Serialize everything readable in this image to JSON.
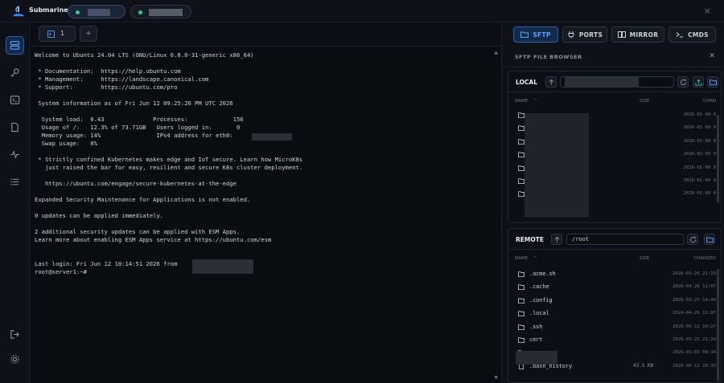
{
  "app": {
    "name": "Submarine"
  },
  "connections": [
    {
      "status_color": "#2ecc8a",
      "label": ""
    },
    {
      "status_color": "#2ecc8a",
      "label": ""
    }
  ],
  "window": {
    "close_icon": "×"
  },
  "rail": {
    "items": [
      {
        "icon": "hosts-icon",
        "active": true
      },
      {
        "icon": "key-icon",
        "active": false
      },
      {
        "icon": "terminal-icon",
        "active": false
      },
      {
        "icon": "file-icon",
        "active": false
      },
      {
        "icon": "activity-icon",
        "active": false
      },
      {
        "icon": "list-icon",
        "active": false
      }
    ],
    "bottom": [
      {
        "icon": "logout-icon"
      },
      {
        "icon": "settings-icon"
      }
    ]
  },
  "tabs": {
    "terminal_tab_label": "1",
    "new_tab_label": "+"
  },
  "terminal": {
    "lines": [
      "Welcome to Ubuntu 24.04 LTS (GNU/Linux 6.8.0-31-generic x86_64)",
      "",
      " * Documentation:  https://help.ubuntu.com",
      " * Management:     https://landscape.canonical.com",
      " * Support:        https://ubuntu.com/pro",
      "",
      " System information as of Fri Jun 12 09:25:26 PM UTC 2026",
      "",
      "  System load:  0.43              Processes:             156",
      "  Usage of /:   12.3% of 73.71GB   Users logged in:       0",
      "  Memory usage: 14%                IPv4 address for eth0:",
      "  Swap usage:   0%",
      "",
      " * Strictly confined Kubernetes makes edge and IoT secure. Learn how MicroK8s",
      "   just raised the bar for easy, resilient and secure K8s cluster deployment.",
      "",
      "   https://ubuntu.com/engage/secure-kubernetes-at-the-edge",
      "",
      "Expanded Security Maintenance for Applications is not enabled.",
      "",
      "0 updates can be applied immediately.",
      "",
      "2 additional security updates can be applied with ESM Apps.",
      "Learn more about enabling ESM Apps service at https://ubuntu.com/esm",
      "",
      "",
      "Last login: Fri Jun 12 10:14:51 2026 from",
      "root@server1:~#"
    ]
  },
  "right_tabs": [
    {
      "label": "SFTP",
      "icon": "folder-icon",
      "active": true
    },
    {
      "label": "PORTS",
      "icon": "plug-icon",
      "active": false
    },
    {
      "label": "MIRROR",
      "icon": "mirror-icon",
      "active": false
    },
    {
      "label": "CMDS",
      "icon": "prompt-icon",
      "active": false
    }
  ],
  "sftp": {
    "title": "SFTP FILE BROWSER",
    "local": {
      "label": "LOCAL",
      "path": "",
      "columns": {
        "name": "NAME",
        "size": "SIZE",
        "date": "CHAN"
      },
      "rows": [
        {
          "name": "",
          "size": "",
          "date": "2026-01-09 0"
        },
        {
          "name": "",
          "size": "",
          "date": "2026-01-09 0"
        },
        {
          "name": "",
          "size": "",
          "date": "2026-01-09 0"
        },
        {
          "name": "",
          "size": "",
          "date": "2026-01-09 0"
        },
        {
          "name": "",
          "size": "",
          "date": "2026-01-09 0"
        },
        {
          "name": "",
          "size": "",
          "date": "2026-01-09 0"
        },
        {
          "name": "",
          "size": "",
          "date": "2026-01-09 0"
        }
      ]
    },
    "remote": {
      "label": "REMOTE",
      "path": "/root",
      "columns": {
        "name": "NAME",
        "size": "SIZE",
        "date": "CHANGED"
      },
      "rows": [
        {
          "name": ".acme.sh",
          "size": "",
          "date": "2026-03-25 21:29"
        },
        {
          "name": ".cache",
          "size": "",
          "date": "2026-04-26 11:07"
        },
        {
          "name": ".config",
          "size": "",
          "date": "2026-03-25 14:40"
        },
        {
          "name": ".local",
          "size": "",
          "date": "2024-04-26 11:07"
        },
        {
          "name": ".ssh",
          "size": "",
          "date": "2026-06-12 10:27"
        },
        {
          "name": "cert",
          "size": "",
          "date": "2026-03-25 21:29"
        },
        {
          "name": "",
          "size": "",
          "date": "2026-03-03 08:34"
        },
        {
          "name": ".bash_history",
          "size": "43.5 KB",
          "date": "2026-06-12 10:35"
        }
      ]
    }
  }
}
